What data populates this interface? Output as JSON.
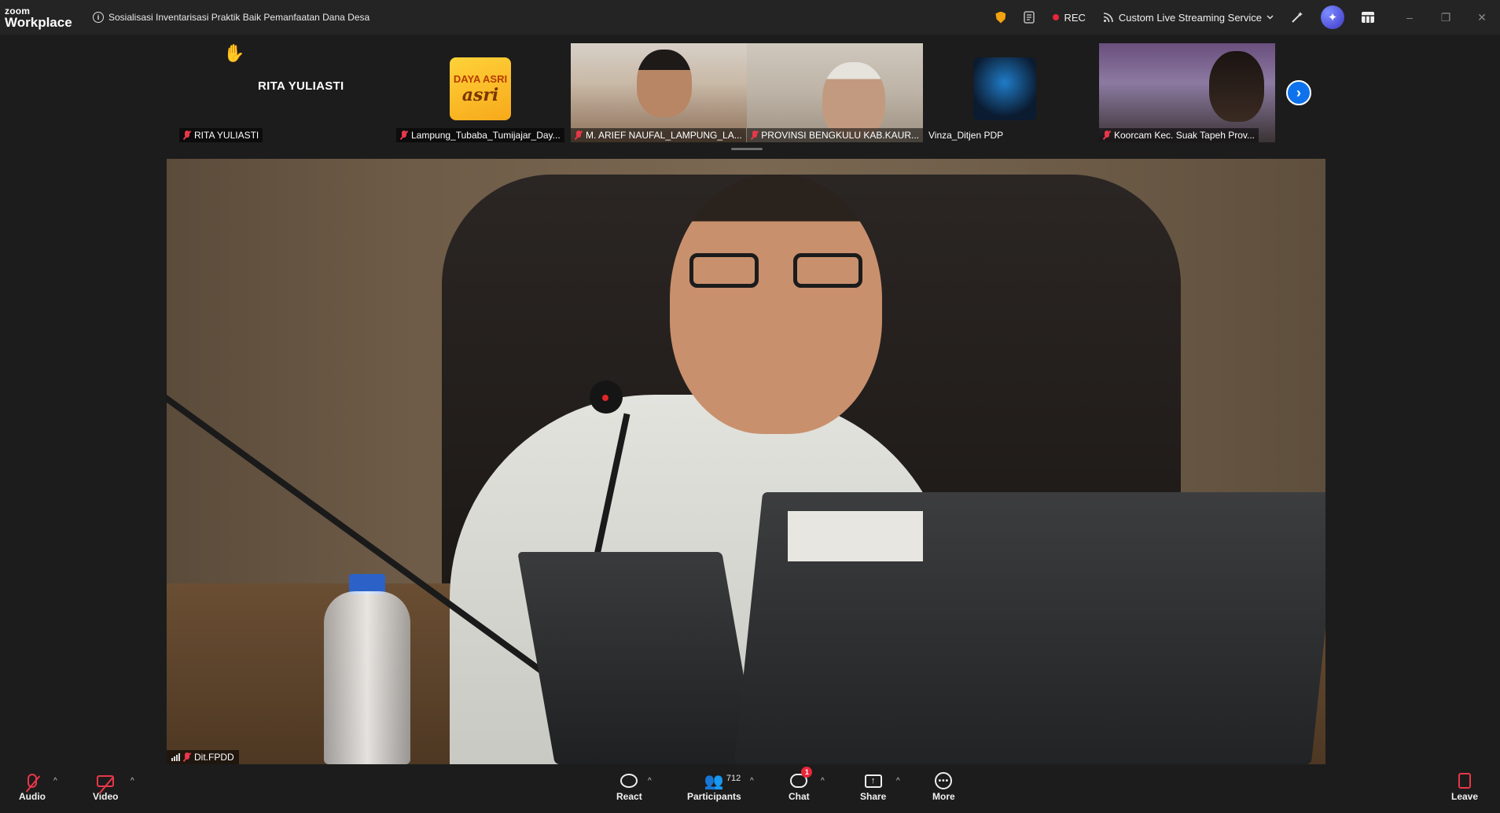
{
  "app": {
    "brand_top": "zoom",
    "brand_bottom": "Workplace",
    "meeting_title": "Sosialisasi Inventarisasi Praktik Baik Pemanfaatan Dana Desa"
  },
  "titlebar": {
    "rec_label": "REC",
    "stream_label": "Custom Live Streaming Service",
    "minimize": "–",
    "restore": "❐",
    "close": "✕"
  },
  "gallery": {
    "tiles": [
      {
        "name": "RITA YULIASTI",
        "display": "RITA YULIASTI"
      },
      {
        "name": "Lampung_Tubaba_Tumijajar_Day...",
        "logo_line1": "DAYA ASRI",
        "logo_line2": "asri"
      },
      {
        "name": "M. ARIEF NAUFAL_LAMPUNG_LA..."
      },
      {
        "name": "PROVINSI BENGKULU KAB.KAUR..."
      },
      {
        "name": "Vinza_Ditjen PDP"
      },
      {
        "name": "Koorcam Kec. Suak Tapeh Prov..."
      }
    ],
    "next": "›"
  },
  "speaker": {
    "name": "Dit.FPDD"
  },
  "toolbar": {
    "audio": "Audio",
    "video": "Video",
    "react": "React",
    "participants": "Participants",
    "participants_count": "712",
    "chat": "Chat",
    "chat_badge": "1",
    "share": "Share",
    "more": "More",
    "leave": "Leave",
    "caret": "^"
  },
  "colors": {
    "accent": "#0e72ed",
    "muted": "#e8374a",
    "bar": "#1c1c1c"
  }
}
